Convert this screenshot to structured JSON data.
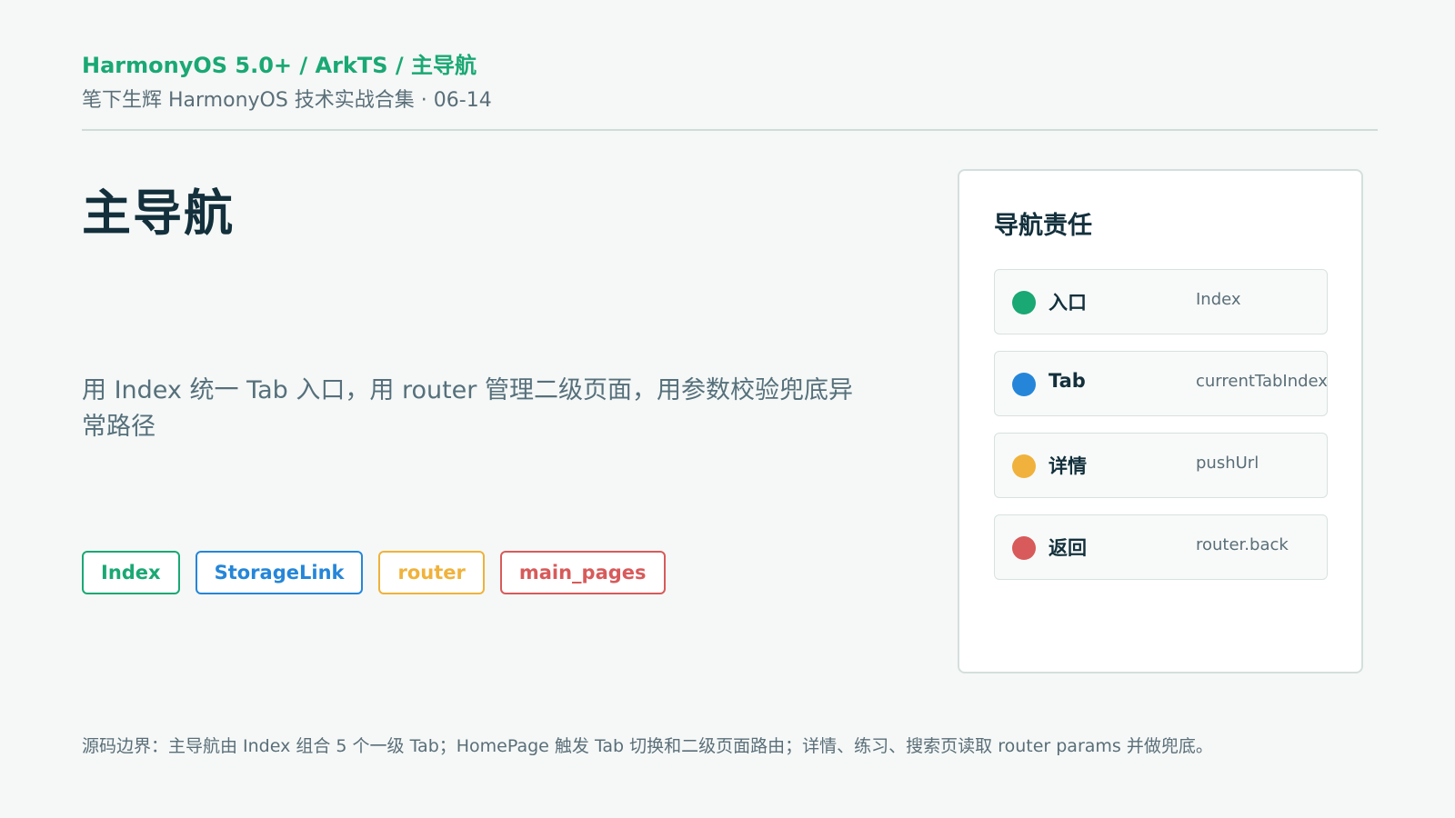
{
  "header": {
    "kicker": "HarmonyOS 5.0+ / ArkTS / 主导航",
    "subtitle": "笔下生辉 HarmonyOS 技术实战合集 · 06-14"
  },
  "main": {
    "title": "主导航",
    "description": "用 Index 统一 Tab 入口，用 router 管理二级页面，用参数校验兜底异常路径",
    "chips": [
      {
        "label": "Index",
        "color": "#1aa874"
      },
      {
        "label": "StorageLink",
        "color": "#2586d9"
      },
      {
        "label": "router",
        "color": "#f0b23c"
      },
      {
        "label": "main_pages",
        "color": "#d85a5a"
      }
    ]
  },
  "panel": {
    "title": "导航责任",
    "items": [
      {
        "label": "入口",
        "value": "Index",
        "color": "#1aa874"
      },
      {
        "label": "Tab",
        "value": "currentTabIndex",
        "color": "#2586d9"
      },
      {
        "label": "详情",
        "value": "pushUrl",
        "color": "#f0b23c"
      },
      {
        "label": "返回",
        "value": "router.back",
        "color": "#d85a5a"
      }
    ]
  },
  "footer": {
    "text": "源码边界：主导航由 Index 组合 5 个一级 Tab；HomePage 触发 Tab 切换和二级页面路由；详情、练习、搜索页读取 router params 并做兜底。"
  }
}
